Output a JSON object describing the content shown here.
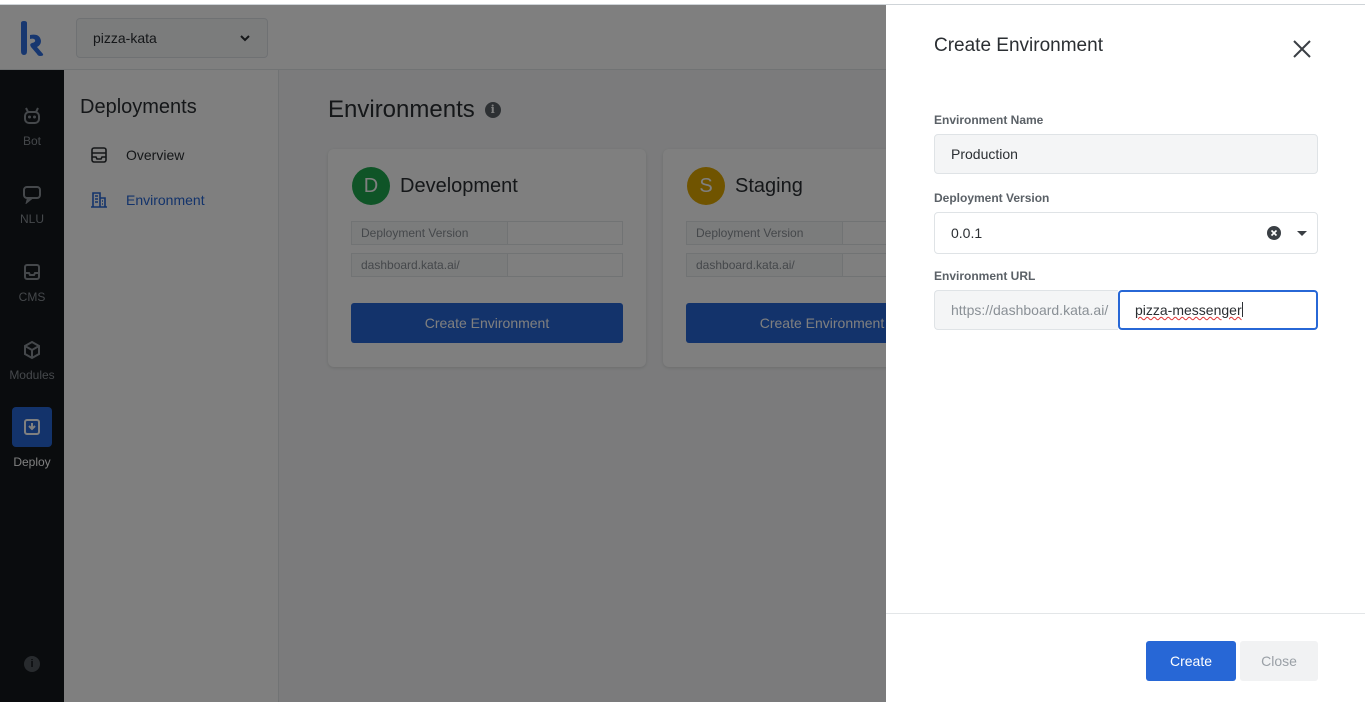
{
  "header": {
    "project": "pizza-kata"
  },
  "rail": {
    "items": [
      {
        "label": "Bot",
        "icon": "bot-icon"
      },
      {
        "label": "NLU",
        "icon": "chat-icon"
      },
      {
        "label": "CMS",
        "icon": "inbox-icon"
      },
      {
        "label": "Modules",
        "icon": "cube-icon"
      },
      {
        "label": "Deploy",
        "icon": "deploy-icon",
        "active": true
      }
    ],
    "info": "i"
  },
  "subnav": {
    "title": "Deployments",
    "items": [
      {
        "label": "Overview",
        "icon": "overview-icon"
      },
      {
        "label": "Environment",
        "icon": "building-icon",
        "active": true
      }
    ]
  },
  "main": {
    "title": "Environments",
    "info": "i",
    "cards": [
      {
        "initial": "D",
        "name": "Development",
        "color": "#1fa84f",
        "rows": [
          "Deployment Version",
          "dashboard.kata.ai/"
        ],
        "button": "Create Environment"
      },
      {
        "initial": "S",
        "name": "Staging",
        "color": "#e0a800",
        "rows": [
          "Deployment Version",
          "dashboard.kata.ai/"
        ],
        "button": "Create Environment"
      }
    ]
  },
  "drawer": {
    "title": "Create Environment",
    "name_label": "Environment Name",
    "name_value": "Production",
    "version_label": "Deployment Version",
    "version_value": "0.0.1",
    "url_label": "Environment URL",
    "url_prefix": "https://dashboard.kata.ai/",
    "url_value": "pizza-messenger",
    "create_label": "Create",
    "close_label": "Close"
  },
  "colors": {
    "accent": "#2767d6",
    "rail": "#14181d"
  }
}
